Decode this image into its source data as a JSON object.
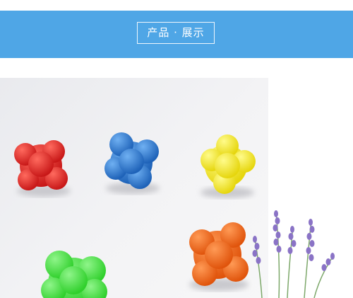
{
  "banner": {
    "title": "产品 · 展示",
    "color": "#4fa6e6"
  },
  "photo": {
    "subject": "reaction-balls",
    "balls": [
      {
        "name": "red-reaction-ball",
        "color": "#e52b2b"
      },
      {
        "name": "blue-reaction-ball",
        "color": "#2f7fd6"
      },
      {
        "name": "yellow-reaction-ball",
        "color": "#f4ec2a"
      },
      {
        "name": "orange-reaction-ball",
        "color": "#f26b1d"
      },
      {
        "name": "green-reaction-ball",
        "color": "#4ee64a"
      }
    ],
    "decoration": "lavender-sprigs"
  }
}
